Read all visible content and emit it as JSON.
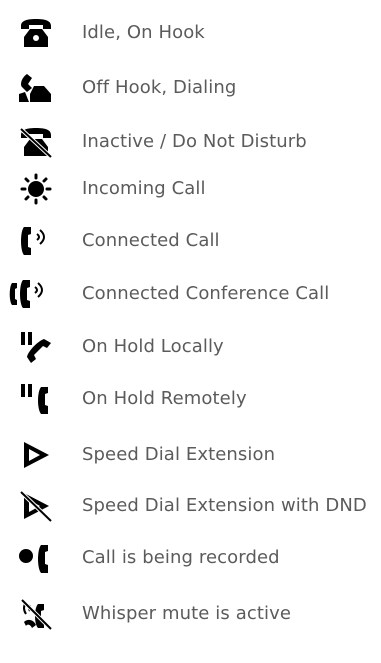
{
  "legend": {
    "items": [
      {
        "label": "Idle, On Hook",
        "icon": "phone-on-hook-icon"
      },
      {
        "label": "Off Hook, Dialing",
        "icon": "phone-off-hook-icon"
      },
      {
        "label": "Inactive / Do Not Disturb",
        "icon": "phone-dnd-icon"
      },
      {
        "label": "Incoming Call",
        "icon": "incoming-call-icon"
      },
      {
        "label": "Connected Call",
        "icon": "connected-call-icon"
      },
      {
        "label": "Connected Conference Call",
        "icon": "conference-call-icon"
      },
      {
        "label": "On Hold Locally",
        "icon": "hold-local-icon"
      },
      {
        "label": "On Hold Remotely",
        "icon": "hold-remote-icon"
      },
      {
        "label": "Speed Dial Extension",
        "icon": "speed-dial-icon"
      },
      {
        "label": "Speed Dial Extension with DND",
        "icon": "speed-dial-dnd-icon"
      },
      {
        "label": "Call is being recorded",
        "icon": "recording-icon"
      },
      {
        "label": "Whisper mute is active",
        "icon": "whisper-mute-icon"
      }
    ]
  },
  "colors": {
    "text": "#5b5b5b",
    "icon": "#000000",
    "background": "#ffffff"
  }
}
